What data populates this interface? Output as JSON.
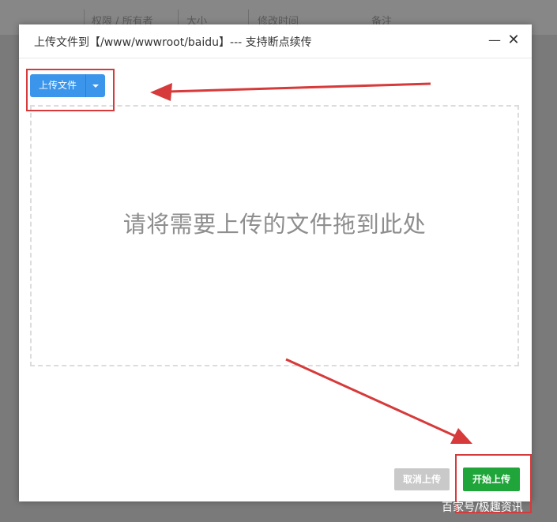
{
  "background_header": {
    "columns": [
      "权限 / 所有者",
      "大小",
      "修改时间",
      "备注"
    ]
  },
  "dialog": {
    "title": "上传文件到【/www/wwwroot/baidu】--- 支持断点续传",
    "minimize_glyph": "—",
    "close_glyph": "✕",
    "upload_button_label": "上传文件",
    "drop_hint": "请将需要上传的文件拖到此处",
    "cancel_button_label": "取消上传",
    "start_button_label": "开始上传"
  },
  "watermark": "百家号/极趣资讯",
  "colors": {
    "primary": "#3b95ea",
    "success": "#20a53a",
    "disabled": "#c9c9c9",
    "annotation": "#d63a3a"
  },
  "icons": [
    "minimize-icon",
    "close-icon",
    "caret-down-icon"
  ]
}
